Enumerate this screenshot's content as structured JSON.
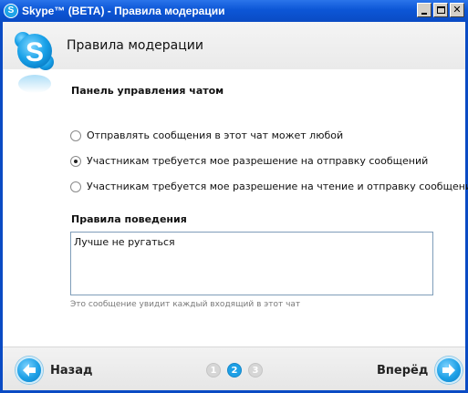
{
  "window": {
    "title": "Skype™ (BETA) - Правила модерации",
    "app_icon_letter": "S",
    "close_symbol": "✕"
  },
  "header": {
    "title": "Правила модерации"
  },
  "chat_panel": {
    "heading": "Панель управления чатом",
    "options": [
      {
        "label": "Отправлять сообщения в этот чат может любой",
        "selected": false
      },
      {
        "label": "Участникам требуется мое разрешение на отправку сообщений",
        "selected": true
      },
      {
        "label": "Участникам требуется мое разрешение на чтение и отправку сообщений",
        "selected": false
      }
    ]
  },
  "rules": {
    "heading": "Правила поведения",
    "value": "Лучше не ругаться",
    "hint": "Это сообщение увидит каждый входящий в этот чат"
  },
  "navigation": {
    "back_label": "Назад",
    "forward_label": "Вперёд",
    "steps": [
      "1",
      "2",
      "3"
    ],
    "current_step": 2
  },
  "colors": {
    "titlebar": "#0a4bc4",
    "accent": "#1ea0e6",
    "step_inactive": "#d6d6d6"
  },
  "icons": {
    "logo": "skype-logo",
    "back": "arrow-left-circle-icon",
    "forward": "arrow-right-circle-icon"
  }
}
